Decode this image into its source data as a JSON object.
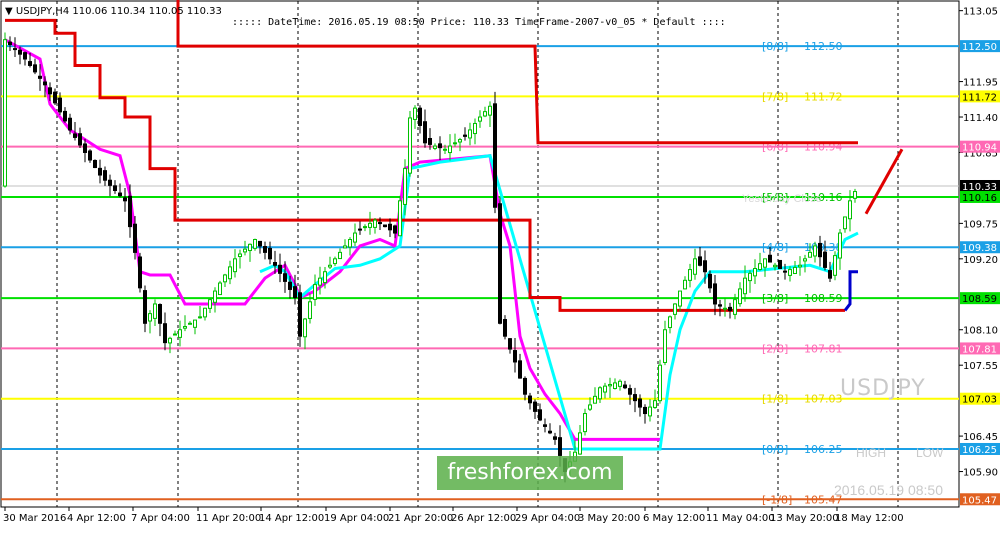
{
  "header": {
    "symbol_line": "USDJPY,H4  110.06 110.34 110.05 110.33",
    "info_line": "::::: DateTime: 2016.05.19 08:50     Price: 110.33     TimeFrame-2007-v0_05     *   Default     ::::"
  },
  "price_axis": {
    "ticks": [
      "113.05",
      "111.95",
      "111.40",
      "110.85",
      "109.75",
      "109.20",
      "108.10",
      "107.55",
      "106.45",
      "105.90"
    ],
    "highlight_labels": [
      {
        "text": "112.50",
        "color": "#1aa0e6"
      },
      {
        "text": "111.72",
        "color": "#ffff00"
      },
      {
        "text": "110.94",
        "color": "#ff69b4"
      },
      {
        "text": "110.33",
        "color": "#000000"
      },
      {
        "text": "110.16",
        "color": "#00e000"
      },
      {
        "text": "109.38",
        "color": "#1aa0e6"
      },
      {
        "text": "108.59",
        "color": "#00e000"
      },
      {
        "text": "107.81",
        "color": "#ff69b4"
      },
      {
        "text": "107.03",
        "color": "#ffff00"
      },
      {
        "text": "106.25",
        "color": "#1aa0e6"
      },
      {
        "text": "105.47",
        "color": "#e06020"
      }
    ]
  },
  "time_axis": [
    "30 Mar 2016",
    "4 Apr 12:00",
    "7 Apr 04:00",
    "11 Apr 20:00",
    "14 Apr 12:00",
    "19 Apr 04:00",
    "21 Apr 20:00",
    "26 Apr 12:00",
    "29 Apr 04:00",
    "3 May 20:00",
    "6 May 12:00",
    "11 May 04:00",
    "13 May 20:00",
    "18 May 12:00"
  ],
  "murrey_levels": [
    {
      "tag": "[8/8]",
      "value": "112.50",
      "color": "#1aa0e6"
    },
    {
      "tag": "[7/8]",
      "value": "111.72",
      "color": "#e6d800"
    },
    {
      "tag": "[6/8]",
      "value": "110.94",
      "color": "#ff69b4"
    },
    {
      "tag": "[5/8]",
      "value": "110.16",
      "color": "#00c000"
    },
    {
      "tag": "[4/8]",
      "value": "109.38",
      "color": "#1aa0e6"
    },
    {
      "tag": "[3/8]",
      "value": "108.59",
      "color": "#00c000"
    },
    {
      "tag": "[2/8]",
      "value": "107.81",
      "color": "#ff69b4"
    },
    {
      "tag": "[1/8]",
      "value": "107.03",
      "color": "#e6d800"
    },
    {
      "tag": "[0/8]",
      "value": "106.25",
      "color": "#1aa0e6"
    },
    {
      "tag": "[-1/8]",
      "value": "105.47",
      "color": "#e06020"
    }
  ],
  "overlay": {
    "watermark": "freshforex.com",
    "symbol": "USDJPY",
    "high": "HIGH",
    "low": "LOW",
    "timestamp": "2016.05.19 08:50",
    "yesterday": "Yesterday Close"
  },
  "colors": {
    "bull_candle": "#00c000",
    "bear_candle": "#000000",
    "magenta_line": "#ff00ff",
    "cyan_line": "#00ffff",
    "red_line": "#e00000"
  }
}
